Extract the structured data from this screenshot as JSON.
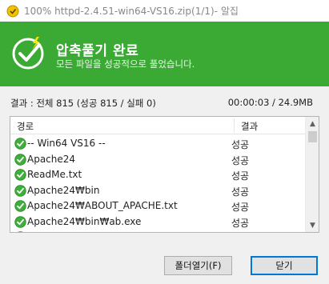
{
  "window": {
    "title": "100% httpd-2.4.51-win64-VS16.zip(1/1)- 알집"
  },
  "banner": {
    "title": "압축풀기 완료",
    "subtitle": "모든 파일을 성공적으로 풀었습니다.",
    "bg_color": "#3aaa35"
  },
  "summary": {
    "result_text": "결과 : 전체 815 (성공 815 / 실패 0)",
    "time_size": "00:00:03 / 24.9MB"
  },
  "list": {
    "columns": [
      "경로",
      "결과"
    ],
    "rows": [
      {
        "path": "-- Win64 VS16  --",
        "result": "성공"
      },
      {
        "path": "Apache24",
        "result": "성공"
      },
      {
        "path": "ReadMe.txt",
        "result": "성공"
      },
      {
        "path": "Apache24₩bin",
        "result": "성공"
      },
      {
        "path": "Apache24₩ABOUT_APACHE.txt",
        "result": "성공"
      },
      {
        "path": "Apache24₩bin₩ab.exe",
        "result": "성공"
      },
      {
        "path": "Apache24₩bin₩ab...",
        "result": "성공"
      }
    ]
  },
  "buttons": {
    "open_folder": "폴더열기(F)",
    "close": "닫기"
  }
}
